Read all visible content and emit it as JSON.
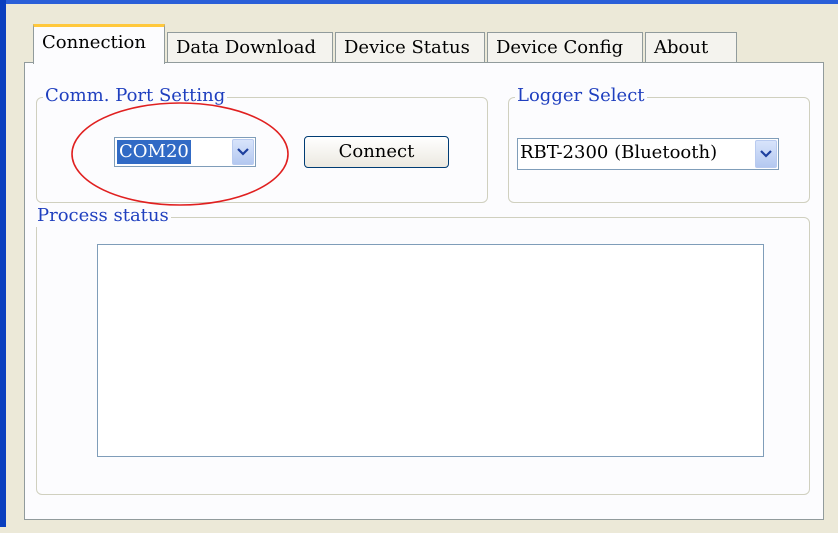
{
  "tabs": [
    {
      "label": "Connection",
      "active": true
    },
    {
      "label": "Data Download",
      "active": false
    },
    {
      "label": "Device Status",
      "active": false
    },
    {
      "label": "Device Config",
      "active": false
    },
    {
      "label": "About",
      "active": false
    }
  ],
  "comm_port": {
    "group_label": "Comm. Port Setting",
    "selected_port": "COM20",
    "connect_label": "Connect"
  },
  "logger": {
    "group_label": "Logger Select",
    "selected": "RBT-2300 (Bluetooth)"
  },
  "process_status": {
    "group_label": "Process status",
    "text": ""
  },
  "colors": {
    "accent": "#316ac5",
    "annotation_circle": "#e02020",
    "tab_highlight": "#ffc83c",
    "group_label": "#1f3fbf"
  },
  "icons": {
    "combo_arrow": "chevron-down-icon"
  }
}
